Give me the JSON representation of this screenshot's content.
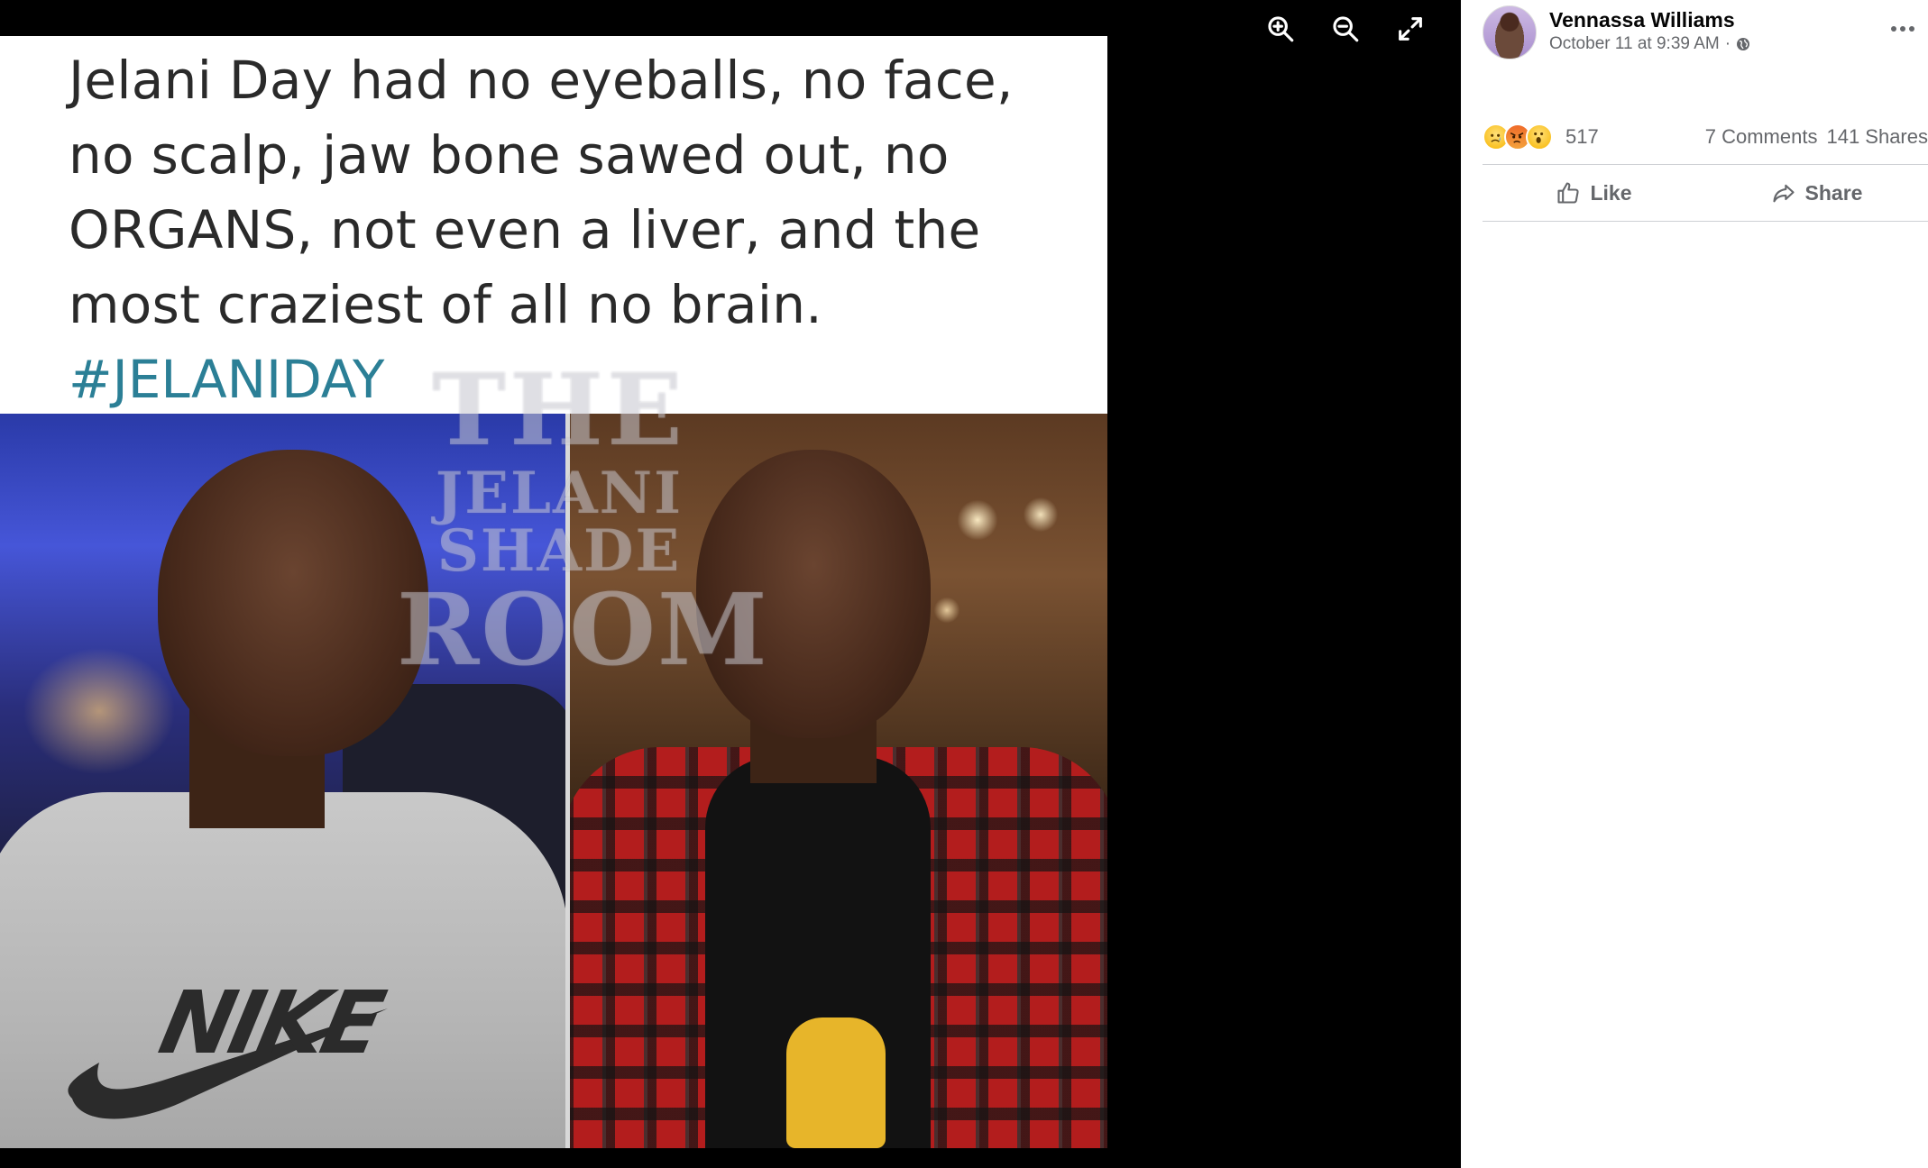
{
  "viewer": {
    "toolbar": {
      "zoom_in_icon": "zoom-in-icon",
      "zoom_out_icon": "zoom-out-icon",
      "fullscreen_icon": "expand-icon"
    },
    "meme": {
      "line1": "Jelani Day had no eyeballs, no face,",
      "line2": "no scalp, jaw bone sawed out, no",
      "line3": "ORGANS, not even a liver, and the",
      "line4": "most craziest of all no brain.",
      "hashtag": "#JELANIDAY",
      "hashtag_color": "#2b7f96",
      "shirt_logo_text": "NIKE",
      "watermark": [
        "THE",
        "JELANI",
        "SHADE",
        "ROOM"
      ]
    }
  },
  "post": {
    "author": "Vennassa Williams",
    "date": "October 11 at 9:39 AM",
    "separator": "·",
    "privacy_icon": "globe-icon",
    "more_icon": "more-horizontal-icon",
    "reactions": {
      "emojis": [
        "sad-emoji",
        "angry-emoji",
        "wow-emoji"
      ],
      "count": "517",
      "comments": "7 Comments",
      "shares": "141 Shares"
    },
    "actions": {
      "like": "Like",
      "share": "Share"
    }
  },
  "colors": {
    "accent_bar": "#3b5cdb",
    "secondary_text": "#65676b",
    "primary_text": "#050505"
  }
}
